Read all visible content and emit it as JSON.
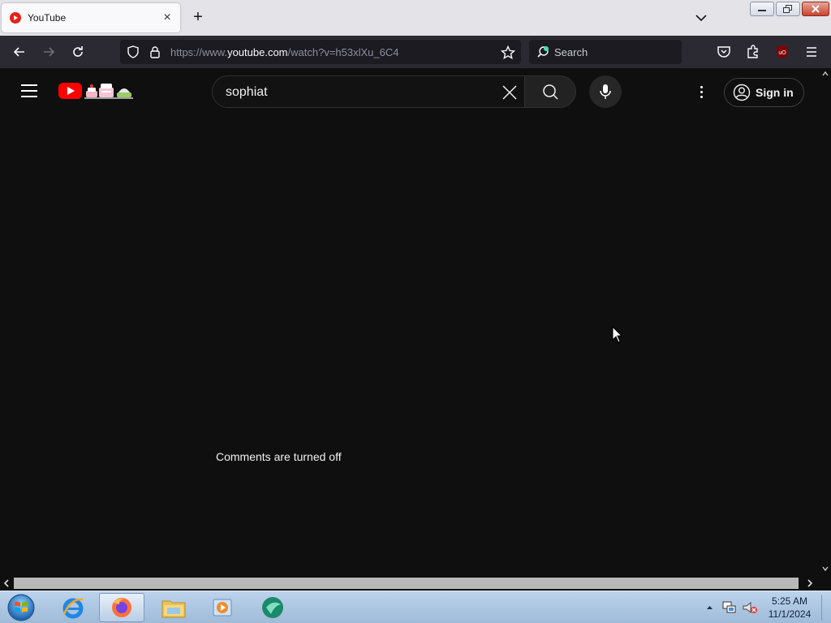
{
  "browser": {
    "tab": {
      "title": "YouTube",
      "close_glyph": "×"
    },
    "new_tab_glyph": "+",
    "url": {
      "prefix": "https://www.",
      "host": "youtube.com",
      "path": "/watch?v=h53xlXu_6C4"
    },
    "search_placeholder": "Search",
    "extension_badge": "49"
  },
  "youtube": {
    "search_query": "sophiat",
    "sign_in_label": "Sign in",
    "comments_status": "Comments are turned off"
  },
  "taskbar": {
    "time": "5:25 AM",
    "date": "11/1/2024"
  },
  "colors": {
    "page_background": "#0f0f0f",
    "youtube_red": "#ff0000",
    "browser_toolbar": "#2b2a33",
    "tab_strip": "#e3e3e8"
  },
  "icons": [
    "youtube-favicon-icon",
    "back-arrow-icon",
    "forward-arrow-icon",
    "reload-icon",
    "shield-icon",
    "lock-icon",
    "bookmark-star-icon",
    "search-icon",
    "pocket-icon",
    "extensions-icon",
    "ublock-icon",
    "menu-icon",
    "hamburger-icon",
    "youtube-logo-icon",
    "clear-icon",
    "microphone-icon",
    "more-vert-icon",
    "account-icon",
    "windows-start-icon",
    "internet-explorer-icon",
    "firefox-icon",
    "file-explorer-icon",
    "media-player-icon",
    "app-icon",
    "tray-arrow-icon",
    "network-icon",
    "volume-muted-icon"
  ]
}
